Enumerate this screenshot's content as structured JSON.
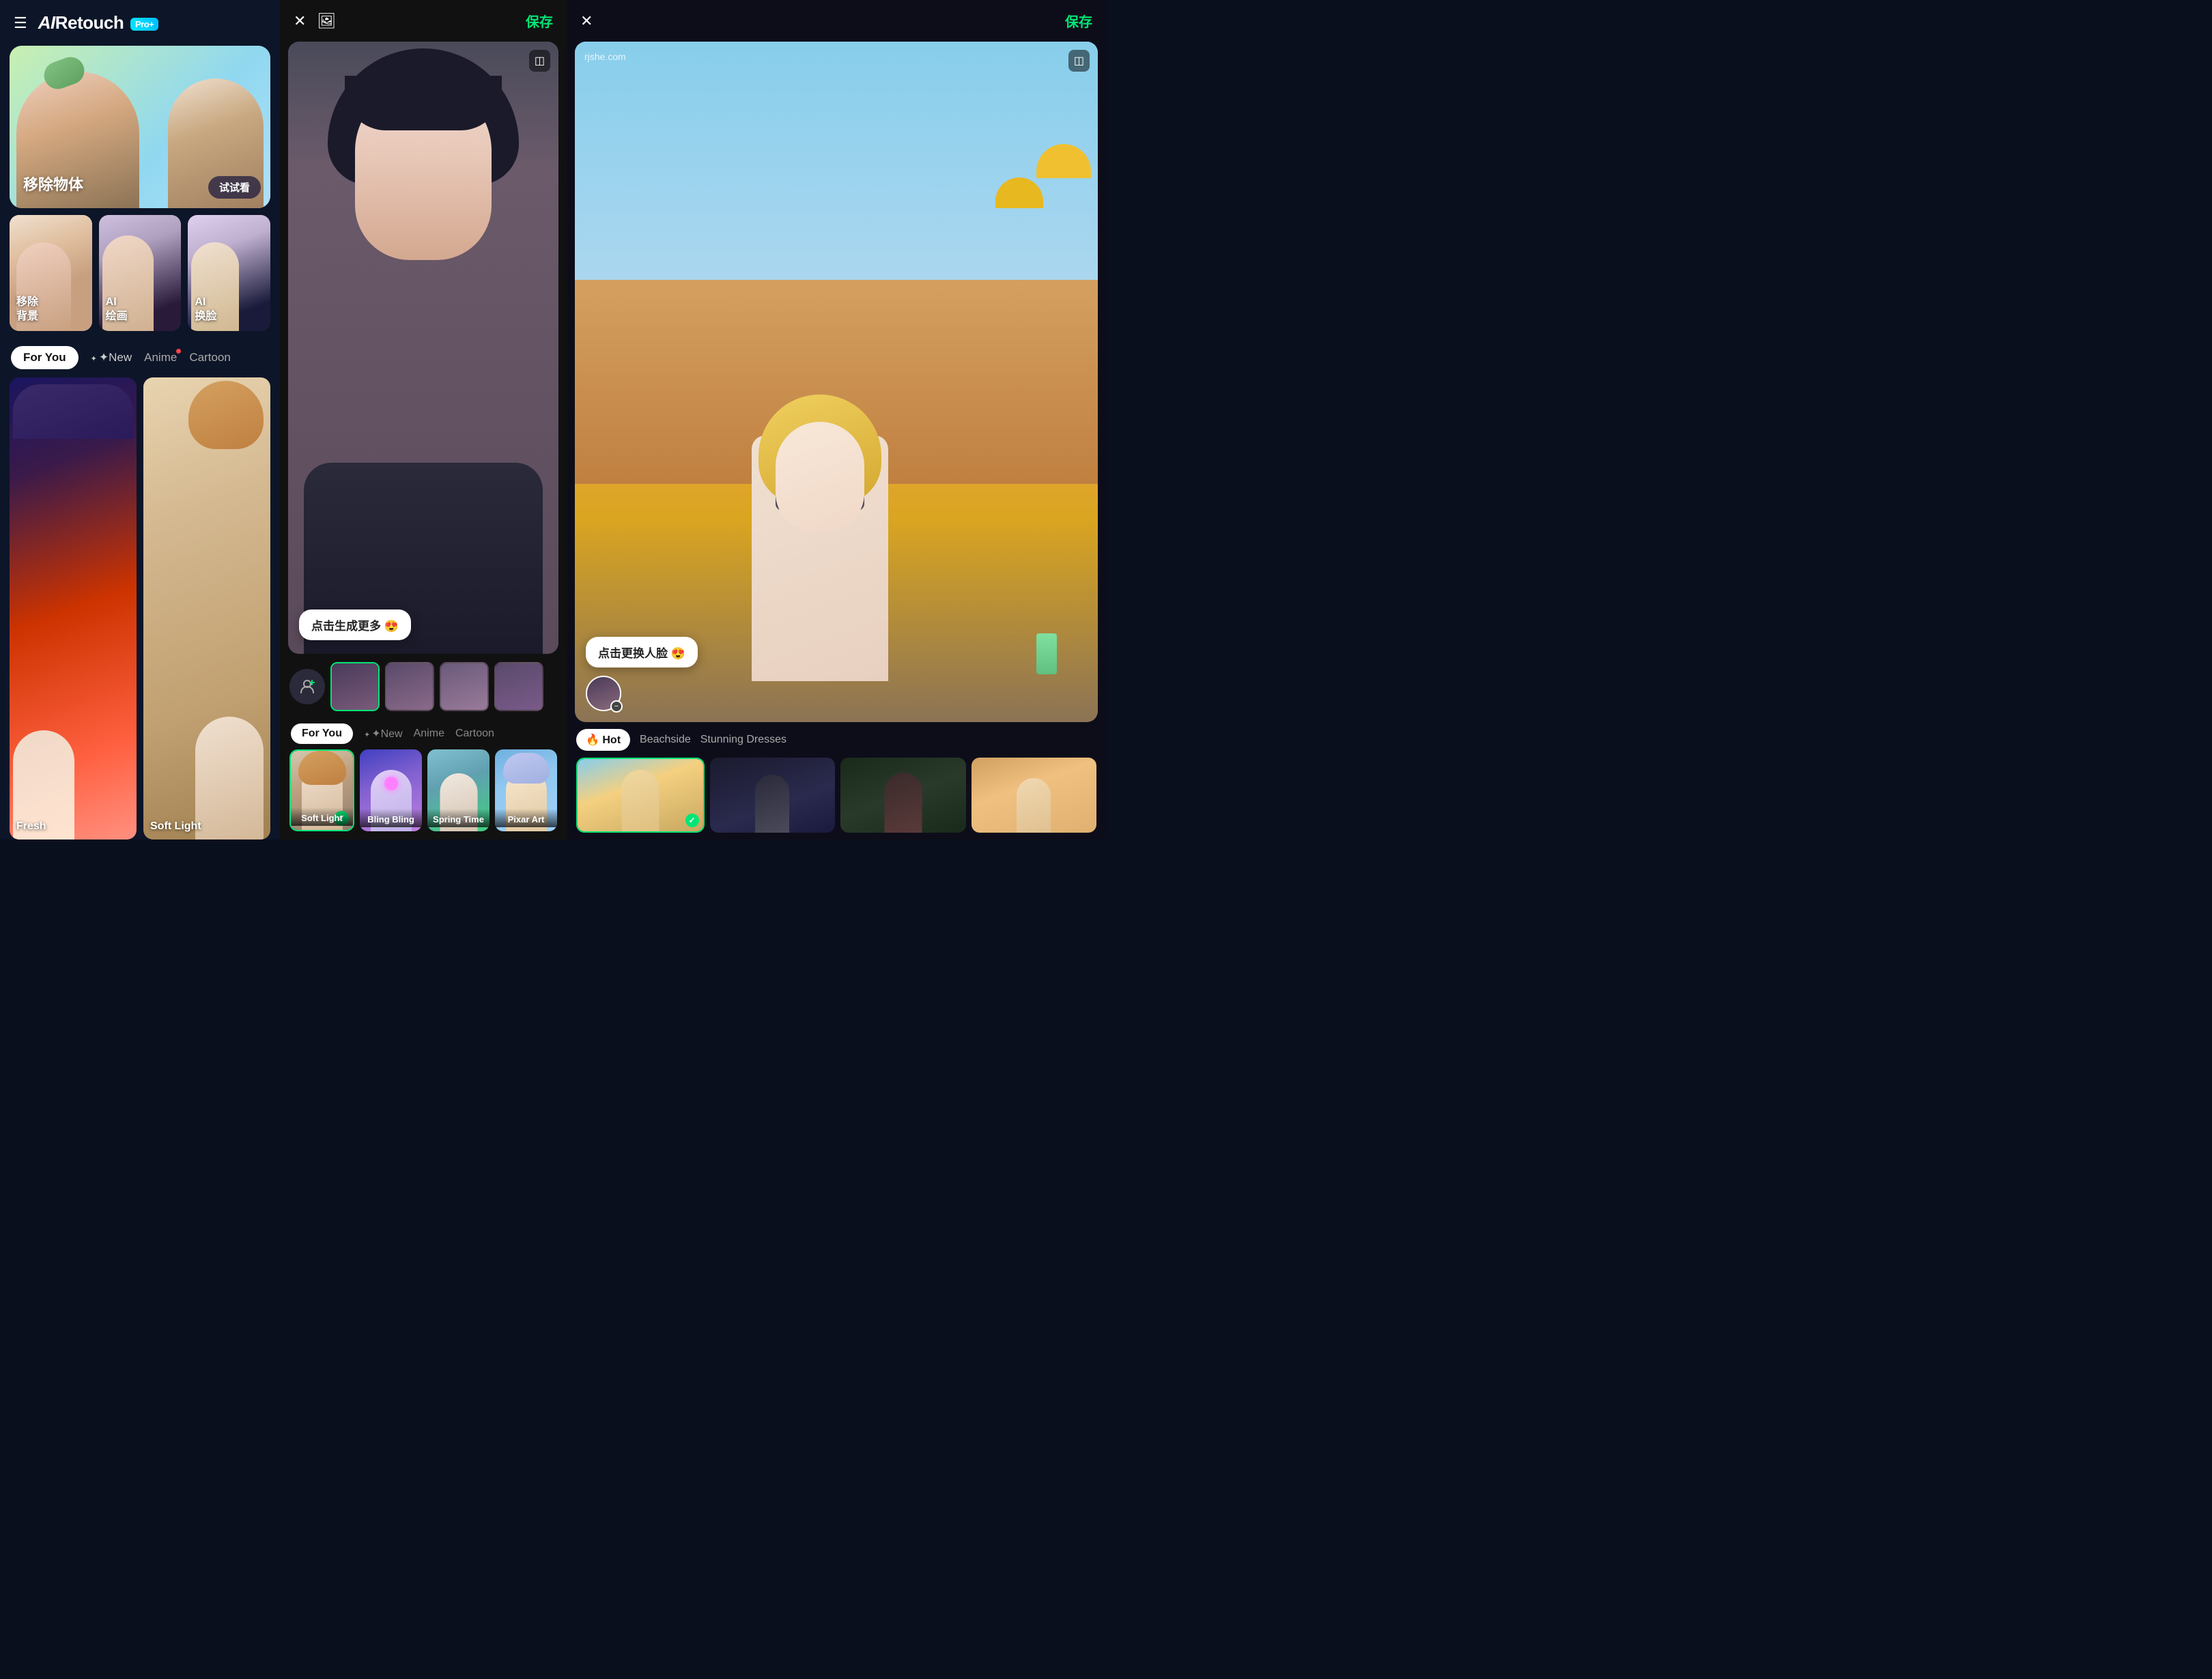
{
  "app": {
    "name": "AI Retouch",
    "pro_badge": "Pro+",
    "logo_text": "AI Retouch"
  },
  "left": {
    "header": {
      "menu_icon": "☰",
      "title": "AI Retouch",
      "pro_label": "Pro+"
    },
    "banner": {
      "label": "移除物体",
      "button": "试试看"
    },
    "features": [
      {
        "label": "移除\n背景"
      },
      {
        "label": "AI\n绘画"
      },
      {
        "label": "AI\n换脸"
      }
    ],
    "tabs": [
      {
        "id": "for-you",
        "label": "For You",
        "active": true
      },
      {
        "id": "new",
        "label": "New",
        "active": false
      },
      {
        "id": "anime",
        "label": "Anime",
        "active": false
      },
      {
        "id": "cartoon",
        "label": "Cartoon",
        "active": false
      }
    ],
    "items": [
      {
        "id": "fresh",
        "label": "Fresh"
      },
      {
        "id": "soft-light",
        "label": "Soft Light"
      }
    ]
  },
  "middle": {
    "save_label": "保存",
    "click_more": "点击生成更多 😍",
    "tabs": [
      {
        "id": "for-you",
        "label": "For You",
        "active": true
      },
      {
        "id": "new",
        "label": "New",
        "active": false
      },
      {
        "id": "anime",
        "label": "Anime",
        "active": false
      },
      {
        "id": "cartoon",
        "label": "Cartoon",
        "active": false
      }
    ],
    "styles": [
      {
        "id": "soft-light",
        "label": "Soft Light",
        "selected": true
      },
      {
        "id": "bling-bling",
        "label": "Bling Bling",
        "selected": false
      },
      {
        "id": "spring-time",
        "label": "Spring Time",
        "selected": false
      },
      {
        "id": "pixar-art",
        "label": "Pixar Art",
        "selected": false
      }
    ]
  },
  "right": {
    "save_label": "保存",
    "watermark": "rjshe.com",
    "click_face": "点击更换人脸 😍",
    "tabs": [
      {
        "id": "hot",
        "label": "Hot",
        "icon": "🔥",
        "active": true
      },
      {
        "id": "beachside",
        "label": "Beachside",
        "active": false
      },
      {
        "id": "stunning",
        "label": "Stunning Dresses",
        "active": false
      }
    ]
  },
  "icons": {
    "close": "✕",
    "image": "🖼",
    "compare": "◫",
    "person_add": "👤+",
    "sparkle": "✦",
    "check": "✓",
    "fire": "🔥"
  }
}
